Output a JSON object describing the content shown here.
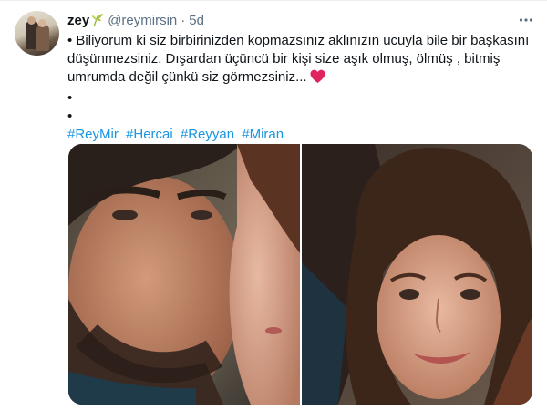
{
  "tweet": {
    "author_name": "zey",
    "handle": "@reymirsin",
    "separator": "·",
    "time": "5d",
    "line1": "• Biliyorum ki siz birbirinizden kopmazsınız aklınızın ucuyla bile bir başkasını",
    "line2": "düşünmezsiniz. Dışardan üçüncü bir kişi size aşık olmuş, ölmüş , bitmiş",
    "line3": "umrumda değil çünkü siz görmezsiniz...",
    "bullet2": "•",
    "bullet3": "•",
    "hashtags": [
      "#ReyMir",
      "#Hercai",
      "#Reyyan",
      "#Miran"
    ]
  },
  "icons": {
    "name_emoji": "leaf-icon",
    "heart_emoji": "heart-icon",
    "more": "more-options-icon"
  },
  "colors": {
    "link": "#1b95e0",
    "secondary": "#5b7083",
    "heart": "#e0245e"
  }
}
